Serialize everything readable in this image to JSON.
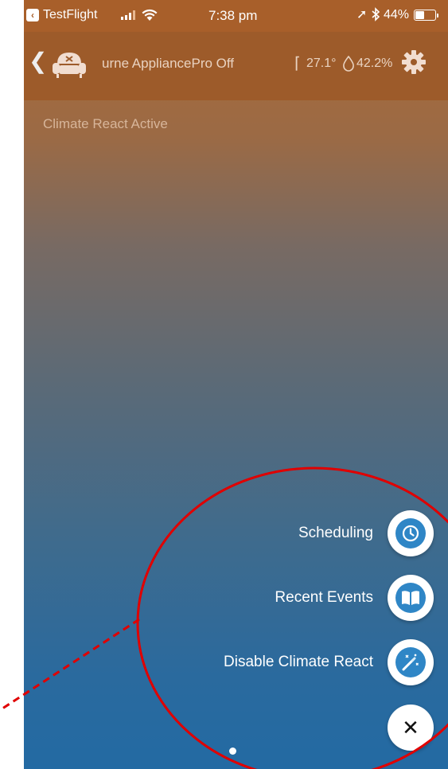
{
  "status_bar": {
    "back_app": "TestFlight",
    "time": "7:38 pm",
    "battery": "44%"
  },
  "nav": {
    "title": "urne  AppliancePro Off",
    "temperature": "27.1°",
    "humidity": "42.2%"
  },
  "banner": {
    "text": "Climate React Active"
  },
  "menu": {
    "items": [
      {
        "label": "Scheduling",
        "icon": "clock-icon"
      },
      {
        "label": "Recent Events",
        "icon": "book-icon"
      },
      {
        "label": "Disable Climate React",
        "icon": "magic-wand-icon"
      }
    ],
    "close_icon": "close-icon"
  },
  "colors": {
    "header": "#9d5b2a",
    "gradient_top": "#ab6c37",
    "gradient_bottom": "#236aa3",
    "accent": "#2f86c6",
    "annotation": "#e00000"
  }
}
